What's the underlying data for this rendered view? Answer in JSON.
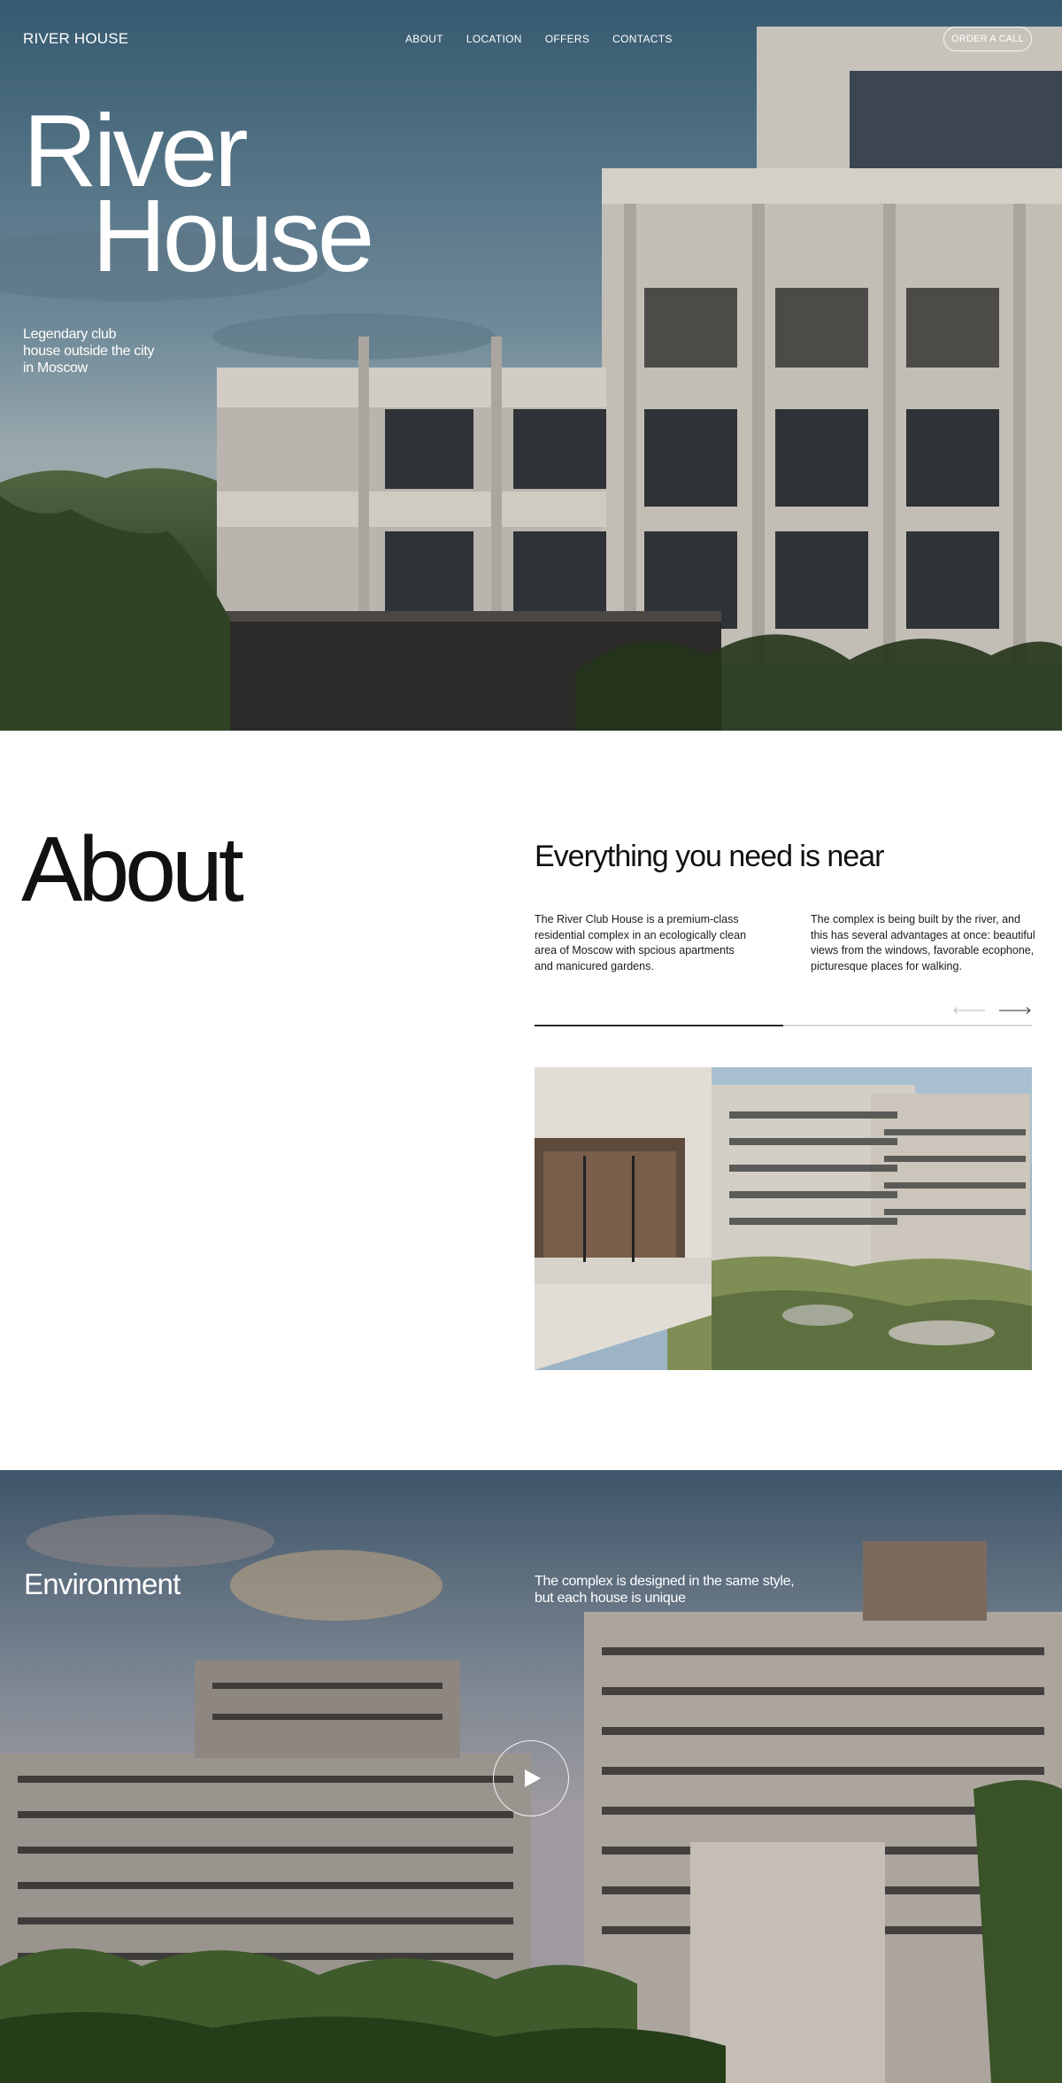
{
  "header": {
    "logo": "RIVER HOUSE",
    "nav": [
      "ABOUT",
      "LOCATION",
      "OFFERS",
      "CONTACTS"
    ],
    "cta_label": "ORDER A CALL"
  },
  "hero": {
    "title_line1": "River",
    "title_line2": "House",
    "subtitle": "Legendary club house outside the city in Moscow"
  },
  "about": {
    "title": "About",
    "heading": "Everything you need is near",
    "paragraph1": "The River Club House is a premium-class residential complex in an ecologically clean area of Moscow with spcious apartments and manicured gardens.",
    "paragraph2": "The complex is being built by the river, and this has several advantages at once: beautiful views from the windows, favorable ecophone, picturesque places for walking.",
    "slider_progress": 0.5,
    "prev_icon": "arrow-left-icon",
    "next_icon": "arrow-right-icon"
  },
  "environment": {
    "title": "Environment",
    "subtitle": "The complex is designed in the same style, but each house is unique",
    "play_icon": "play-icon"
  },
  "colors": {
    "text_dark": "#141414",
    "white": "#ffffff",
    "progress_track": "#d6d6d6",
    "progress_fill": "#2a2a2a"
  }
}
